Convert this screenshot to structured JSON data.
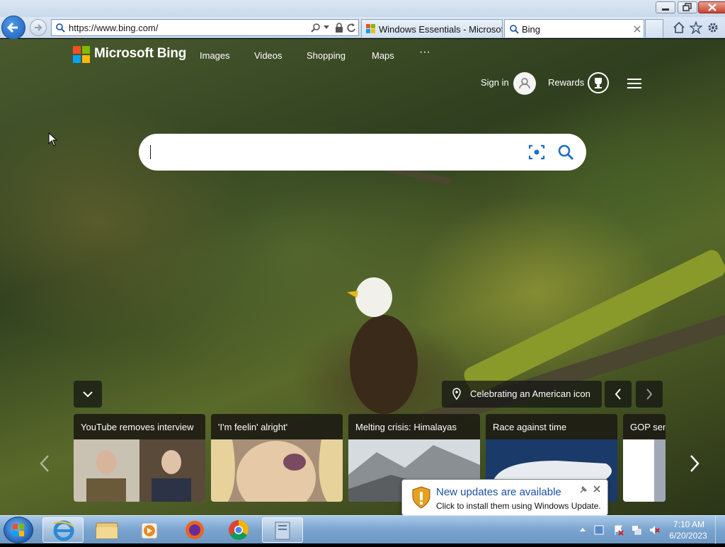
{
  "browser": {
    "address_url": "https://www.bing.com/",
    "tabs": [
      {
        "label": "Windows Essentials - Microsof...",
        "active": false
      },
      {
        "label": "Bing",
        "active": true
      }
    ]
  },
  "bing": {
    "brand": "Microsoft Bing",
    "nav": [
      "Images",
      "Videos",
      "Shopping",
      "Maps",
      "···"
    ],
    "sign_in": "Sign in",
    "rewards": "Rewards",
    "search_value": "",
    "image_caption": "Celebrating an American icon",
    "news_cards": [
      {
        "title": "YouTube removes interview"
      },
      {
        "title": "'I'm feelin' alright'"
      },
      {
        "title": "Melting crisis: Himalayas"
      },
      {
        "title": "Race against time"
      },
      {
        "title": "GOP sen"
      }
    ]
  },
  "notification": {
    "title": "New updates are available",
    "body": "Click to install them using Windows Update."
  },
  "taskbar": {
    "time": "7:10 AM",
    "date": "6/20/2023",
    "pinned": [
      "internet-explorer",
      "file-explorer",
      "media-player",
      "firefox",
      "chrome",
      "windows-update-app"
    ]
  },
  "colors": {
    "ie_blue": "#1b5cb5",
    "notif_title": "#1d4fa0",
    "taskbar": "#7aa4cf"
  }
}
